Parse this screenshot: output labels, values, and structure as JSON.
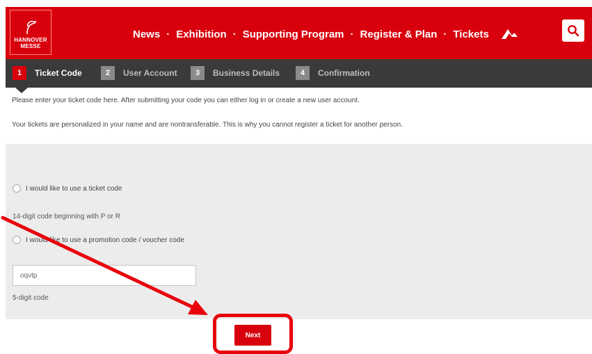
{
  "header": {
    "logo": {
      "line1": "HANNOVER",
      "line2": "MESSE"
    },
    "nav": [
      {
        "label": "News"
      },
      {
        "label": "Exhibition"
      },
      {
        "label": "Supporting Program"
      },
      {
        "label": "Register & Plan"
      },
      {
        "label": "Tickets"
      }
    ],
    "separator": "·",
    "icons": {
      "nav": "arrow-logo-icon",
      "search": "search-icon"
    }
  },
  "steps": [
    {
      "num": "1",
      "label": "Ticket Code",
      "active": true
    },
    {
      "num": "2",
      "label": "User Account",
      "active": false
    },
    {
      "num": "3",
      "label": "Business Details",
      "active": false
    },
    {
      "num": "4",
      "label": "Confirmation",
      "active": false
    }
  ],
  "intro": {
    "line1": "Please enter your ticket code here. After submitting your code you can either log in or create a new user account.",
    "line2": "Your tickets are personalized in your name and are nontransferable. This is why you cannot register a ticket for another person."
  },
  "form": {
    "option_ticket": "I would like to use a ticket code",
    "ticket_hint": "14-digit code beginning with P or R",
    "option_promo": "I would like to use a promotion code / voucher code",
    "code_value": "oqvtp",
    "code_hint": "5-digit code",
    "next_label": "Next"
  },
  "colors": {
    "brand": "#d9000d",
    "steps_bg": "#3a3a3a",
    "form_bg": "#ececec",
    "annotation": "#e8000b"
  }
}
